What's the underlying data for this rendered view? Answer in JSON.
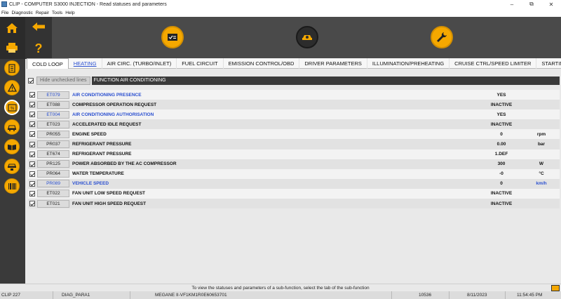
{
  "window": {
    "title": "CLIP - COMPUTER S3000 INJECTION - Read statuses and parameters",
    "controls": [
      "–",
      "⧉",
      "✕"
    ]
  },
  "menu": [
    "File",
    "Diagnostic",
    "Repair",
    "Tools",
    "Help"
  ],
  "tabs": [
    {
      "label": "COLD LOOP",
      "active": true
    },
    {
      "label": "HEATING",
      "active": false
    },
    {
      "label": "AIR CIRC. (TURBO/INLET)",
      "active": false
    },
    {
      "label": "FUEL CIRCUIT",
      "active": false
    },
    {
      "label": "EMISSION CONTROL/OBD",
      "active": false
    },
    {
      "label": "DRIVER PARAMETERS",
      "active": false
    },
    {
      "label": "ILLUMINATION/PREHEATING",
      "active": false
    },
    {
      "label": "CRUISE CTRL/SPEED LIMITER",
      "active": false
    },
    {
      "label": "STARTIN",
      "active": false
    }
  ],
  "tab_scroll": {
    "left": "◂",
    "right": "▸"
  },
  "filter": {
    "hide_label": "Hide unchecked lines",
    "function_name": "FUNCTION AIR CONDITIONING"
  },
  "rows": [
    {
      "code": "ET079",
      "label": "AIR CONDITIONING PRESENCE",
      "value": "YES",
      "unit": "",
      "blue": true
    },
    {
      "code": "ET088",
      "label": "COMPRESSOR OPERATION REQUEST",
      "value": "INACTIVE",
      "unit": "",
      "blue": false
    },
    {
      "code": "ET004",
      "label": "AIR CONDITIONING AUTHORISATION",
      "value": "YES",
      "unit": "",
      "blue": true
    },
    {
      "code": "ET023",
      "label": "ACCELERATED IDLE REQUEST",
      "value": "INACTIVE",
      "unit": "",
      "blue": false
    },
    {
      "code": "PR055",
      "label": "ENGINE SPEED",
      "value": "0",
      "unit": "rpm",
      "blue": false
    },
    {
      "code": "PR037",
      "label": "REFRIGERANT PRESSURE",
      "value": "0.00",
      "unit": "bar",
      "blue": false
    },
    {
      "code": "ET674",
      "label": "REFRIGERANT PRESSURE",
      "value": "1.DEF",
      "unit": "",
      "blue": false
    },
    {
      "code": "PR125",
      "label": "POWER ABSORBED BY THE AC COMPRESSOR",
      "value": "300",
      "unit": "W",
      "blue": false
    },
    {
      "code": "PR064",
      "label": "WATER TEMPERATURE",
      "value": "-0",
      "unit": "°C",
      "blue": false
    },
    {
      "code": "PR089",
      "label": "VEHICLE SPEED",
      "value": "0",
      "unit": "km/h",
      "blue": true
    },
    {
      "code": "ET022",
      "label": "FAN UNIT LOW SPEED REQUEST",
      "value": "INACTIVE",
      "unit": "",
      "blue": false
    },
    {
      "code": "ET021",
      "label": "FAN UNIT HIGH SPEED REQUEST",
      "value": "INACTIVE",
      "unit": "",
      "blue": false
    }
  ],
  "hint": "To view the statuses and parameters of a sub-function, select the tab of the sub-function",
  "status": {
    "clip": "CLIP 227",
    "diag": "DIAG_PARA1",
    "vehicle": "MEGANE II-VF1KM1R0E60653701",
    "code": "10536",
    "date": "8/11/2023",
    "time": "11:54:45 PM"
  },
  "icons": {
    "sidebar": [
      "home-icon",
      "printer-icon",
      "document-icon",
      "warning-icon",
      "parameters-icon",
      "car-icon",
      "book-icon",
      "car-repair-icon",
      "barcode-icon"
    ],
    "toolbar": [
      "back-arrow-icon",
      "help-question-icon",
      "checklist-icon",
      "car-scan-icon",
      "wrench-icon"
    ]
  },
  "colors": {
    "accent": "#f5a800",
    "blue_text": "#2a4fd0"
  }
}
